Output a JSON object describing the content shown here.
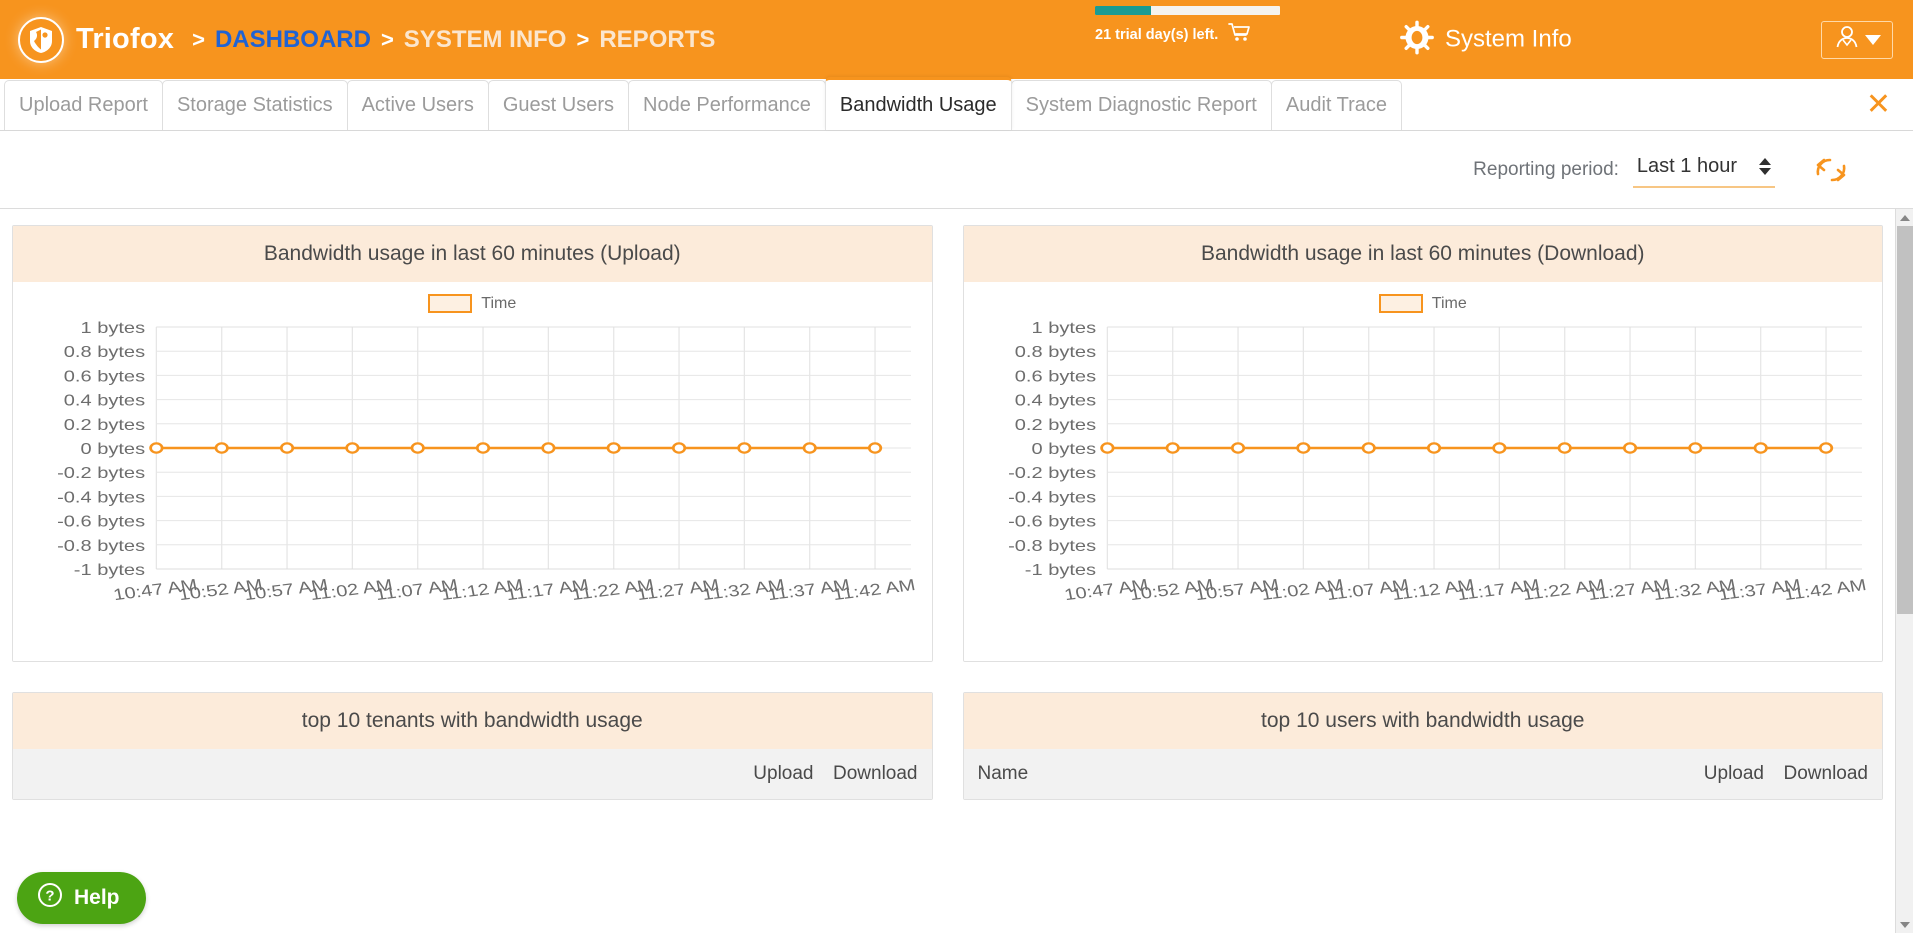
{
  "header": {
    "brand": "Triofox",
    "breadcrumb": [
      {
        "label": "Dashboard",
        "text": "DASHBOARD",
        "style": "link"
      },
      {
        "label": "System Info",
        "text": "SYSTEM INFO",
        "style": "plain"
      },
      {
        "label": "Reports",
        "text": "REPORTS",
        "style": "plain"
      }
    ],
    "separator": ">",
    "trial_text": "21 trial day(s) left.",
    "trial_progress_percent": 30,
    "trial_bar_fill_color": "#1C9B92",
    "cart_icon": "shopping-cart-icon",
    "system_info_label": "System Info",
    "gear_icon": "gear-icon",
    "user_icon": "user-avatar-icon",
    "caret_icon": "chevron-down-icon",
    "background_color": "#F7941E"
  },
  "tabs": [
    {
      "label": "Upload Report",
      "active": false
    },
    {
      "label": "Storage Statistics",
      "active": false
    },
    {
      "label": "Active Users",
      "active": false
    },
    {
      "label": "Guest Users",
      "active": false
    },
    {
      "label": "Node Performance",
      "active": false
    },
    {
      "label": "Bandwidth Usage",
      "active": true
    },
    {
      "label": "System Diagnostic Report",
      "active": false
    },
    {
      "label": "Audit Trace",
      "active": false
    }
  ],
  "close_button": "✕",
  "toolbar": {
    "reporting_period_label": "Reporting period:",
    "reporting_period_value": "Last 1 hour",
    "reporting_period_options": [
      "Last 1 hour"
    ],
    "refresh_icon": "refresh-icon",
    "accent_color": "#F7941E"
  },
  "chart_data": [
    {
      "type": "line",
      "id": "upload",
      "title": "Bandwidth usage in last 60 minutes (Upload)",
      "legend": [
        "Time"
      ],
      "legend_position": "top-center",
      "legend_swatch_color": "#F7941E",
      "xlabel": "",
      "ylabel": "",
      "grid": true,
      "ylim": [
        -1,
        1
      ],
      "ytick_labels": [
        "1 bytes",
        "0.8 bytes",
        "0.6 bytes",
        "0.4 bytes",
        "0.2 bytes",
        "0 bytes",
        "-0.2 bytes",
        "-0.4 bytes",
        "-0.6 bytes",
        "-0.8 bytes",
        "-1 bytes"
      ],
      "ytick_values": [
        1,
        0.8,
        0.6,
        0.4,
        0.2,
        0,
        -0.2,
        -0.4,
        -0.6,
        -0.8,
        -1
      ],
      "categories": [
        "10:47 AM",
        "10:52 AM",
        "10:57 AM",
        "11:02 AM",
        "11:07 AM",
        "11:12 AM",
        "11:17 AM",
        "11:22 AM",
        "11:27 AM",
        "11:32 AM",
        "11:37 AM",
        "11:42 AM"
      ],
      "series": [
        {
          "name": "Time",
          "color": "#F7941E",
          "values": [
            0,
            0,
            0,
            0,
            0,
            0,
            0,
            0,
            0,
            0,
            0,
            0
          ]
        }
      ]
    },
    {
      "type": "line",
      "id": "download",
      "title": "Bandwidth usage in last 60 minutes (Download)",
      "legend": [
        "Time"
      ],
      "legend_position": "top-center",
      "legend_swatch_color": "#F7941E",
      "xlabel": "",
      "ylabel": "",
      "grid": true,
      "ylim": [
        -1,
        1
      ],
      "ytick_labels": [
        "1 bytes",
        "0.8 bytes",
        "0.6 bytes",
        "0.4 bytes",
        "0.2 bytes",
        "0 bytes",
        "-0.2 bytes",
        "-0.4 bytes",
        "-0.6 bytes",
        "-0.8 bytes",
        "-1 bytes"
      ],
      "ytick_values": [
        1,
        0.8,
        0.6,
        0.4,
        0.2,
        0,
        -0.2,
        -0.4,
        -0.6,
        -0.8,
        -1
      ],
      "categories": [
        "10:47 AM",
        "10:52 AM",
        "10:57 AM",
        "11:02 AM",
        "11:07 AM",
        "11:12 AM",
        "11:17 AM",
        "11:22 AM",
        "11:27 AM",
        "11:32 AM",
        "11:37 AM",
        "11:42 AM"
      ],
      "series": [
        {
          "name": "Time",
          "color": "#F7941E",
          "values": [
            0,
            0,
            0,
            0,
            0,
            0,
            0,
            0,
            0,
            0,
            0,
            0
          ]
        }
      ]
    }
  ],
  "tables": {
    "tenants": {
      "title": "top 10 tenants with bandwidth usage",
      "columns": [
        "",
        "Upload",
        "Download"
      ],
      "col_name": "",
      "col_upload": "Upload",
      "col_download": "Download",
      "rows": []
    },
    "users": {
      "title": "top 10 users with bandwidth usage",
      "columns": [
        "Name",
        "Upload",
        "Download"
      ],
      "col_name": "Name",
      "col_upload": "Upload",
      "col_download": "Download",
      "rows": []
    }
  },
  "help": {
    "label": "Help",
    "icon": "question-mark-icon",
    "color": "#4CA413"
  }
}
